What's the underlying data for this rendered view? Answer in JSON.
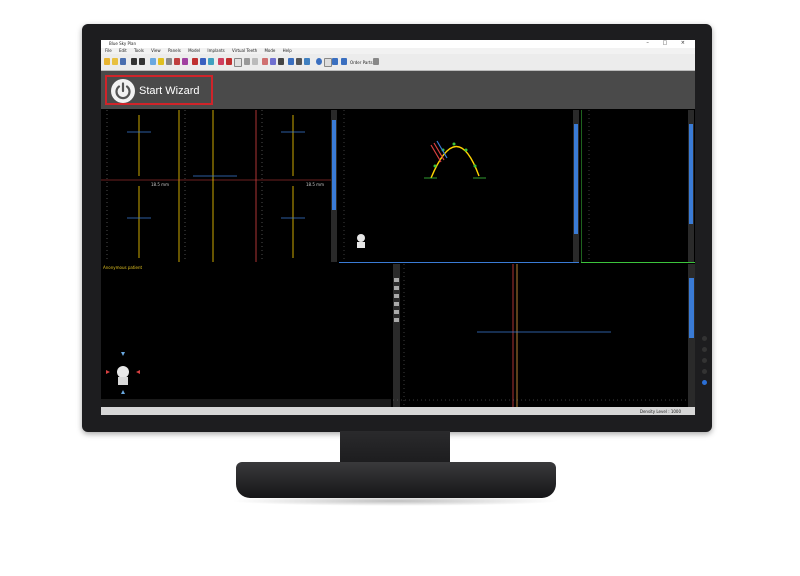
{
  "app": {
    "title": "Blue Sky Plan",
    "window_controls": "– □ ×"
  },
  "menu": [
    "File",
    "Edit",
    "Tools",
    "View",
    "Panels",
    "Model",
    "Implants",
    "Virtual Teeth",
    "Mode",
    "Help"
  ],
  "toolbar": {
    "order_parts_label": "Order Parts"
  },
  "wizard": {
    "label": "Start Wizard"
  },
  "viewports": {
    "patient_label": "Anonymous patient",
    "measure_1": "18.5 mm",
    "measure_2": "18.5 mm"
  },
  "status": {
    "density": "Density Level : 1000"
  },
  "colors": {
    "accent_red": "#d0242a",
    "axis_yellow": "#ffd400",
    "axis_blue": "#3a7bd5",
    "axis_red": "#d84040",
    "axis_green": "#3cc43c"
  }
}
